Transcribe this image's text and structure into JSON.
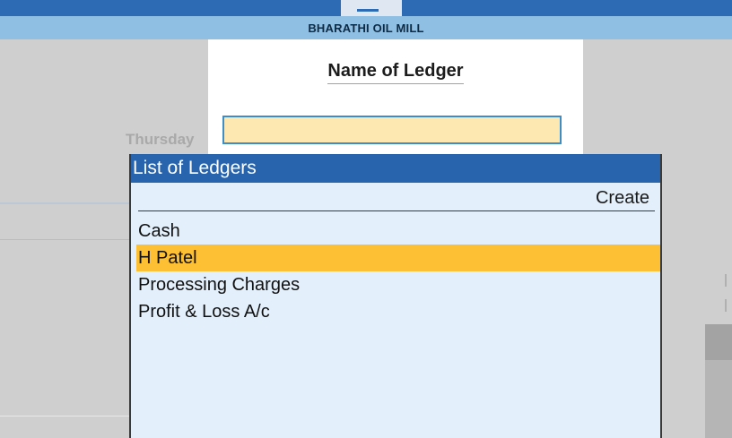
{
  "window": {
    "company_name": "BHARATHI OIL MILL"
  },
  "background": {
    "date_text": "Thursday"
  },
  "ledger_form": {
    "title": "Name of Ledger",
    "input_value": "",
    "input_placeholder": ""
  },
  "ledger_list": {
    "title": "List of Ledgers",
    "create_label": "Create",
    "items": [
      {
        "label": "Cash",
        "selected": false
      },
      {
        "label": "H Patel",
        "selected": true
      },
      {
        "label": "Processing Charges",
        "selected": false
      },
      {
        "label": "Profit & Loss A/c",
        "selected": false
      }
    ]
  },
  "colors": {
    "title_bar": "#2d6bb4",
    "company_bar": "#8fbfe2",
    "list_header": "#2864ad",
    "list_background": "#e3effa",
    "selection_highlight": "#fdc034",
    "input_background": "#fde8b2",
    "input_border": "#3c8dc8",
    "backdrop": "#cfcfcf"
  }
}
